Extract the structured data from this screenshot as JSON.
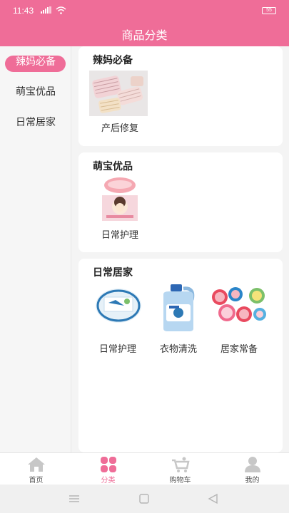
{
  "status_bar": {
    "time": "11:43",
    "battery": "55",
    "signal_icon": "signal-icon",
    "wifi_icon": "wifi-icon"
  },
  "header": {
    "title": "商品分类"
  },
  "sidebar": {
    "items": [
      {
        "label": "辣妈必备",
        "active": true
      },
      {
        "label": "萌宝优品",
        "active": false
      },
      {
        "label": "日常居家",
        "active": false
      }
    ]
  },
  "sections": [
    {
      "title": "辣妈必备",
      "items": [
        {
          "label": "产后修复",
          "icon": "postpartum-product-image"
        }
      ]
    },
    {
      "title": "萌宝优品",
      "items": [
        {
          "label": "日常护理",
          "icon": "baby-cream-jar-image"
        }
      ]
    },
    {
      "title": "日常居家",
      "items": [
        {
          "label": "日常护理",
          "icon": "cream-tub-image"
        },
        {
          "label": "衣物清洗",
          "icon": "detergent-bottle-image"
        },
        {
          "label": "居家常备",
          "icon": "cartoon-containers-image"
        }
      ]
    }
  ],
  "tab_bar": {
    "tabs": [
      {
        "label": "首页",
        "icon": "home-icon"
      },
      {
        "label": "分类",
        "icon": "category-icon",
        "active": true
      },
      {
        "label": "购物车",
        "icon": "cart-icon"
      },
      {
        "label": "我的",
        "icon": "profile-icon"
      }
    ]
  },
  "colors": {
    "accent": "#ef6d98",
    "background": "#f4f4f4"
  }
}
